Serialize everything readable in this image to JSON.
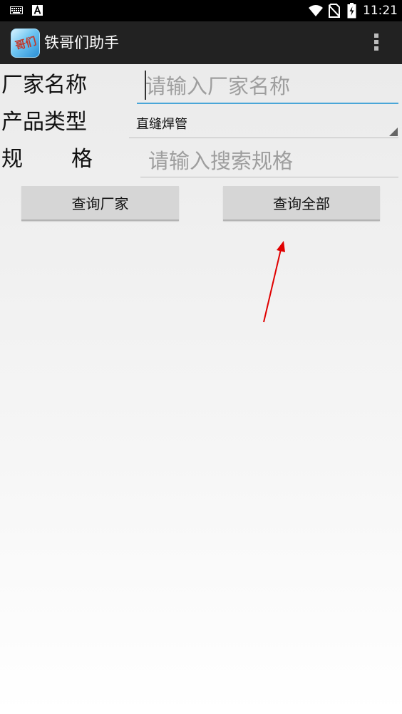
{
  "status_bar": {
    "time": "11:21",
    "icons": [
      "keyboard-icon",
      "a-notification-icon",
      "wifi-icon",
      "no-sim-icon",
      "battery-charging-icon"
    ]
  },
  "action_bar": {
    "title": "铁哥们助手",
    "app_icon_glyph": "哥们",
    "overflow_icon": "overflow-menu-icon"
  },
  "form": {
    "manufacturer": {
      "label": "厂家名称",
      "placeholder": "请输入厂家名称",
      "value": ""
    },
    "product_type": {
      "label": "产品类型",
      "selected": "直缝焊管"
    },
    "spec": {
      "label_first": "规",
      "label_second": "格",
      "placeholder": "请输入搜索规格",
      "value": ""
    }
  },
  "buttons": {
    "query_manufacturer": "查询厂家",
    "query_all": "查询全部"
  },
  "colors": {
    "status_bar_bg": "#000000",
    "action_bar_bg": "#222222",
    "focus_underline": "#4aa6d8",
    "button_bg": "#d6d6d6",
    "annotation_arrow": "#e00000"
  }
}
